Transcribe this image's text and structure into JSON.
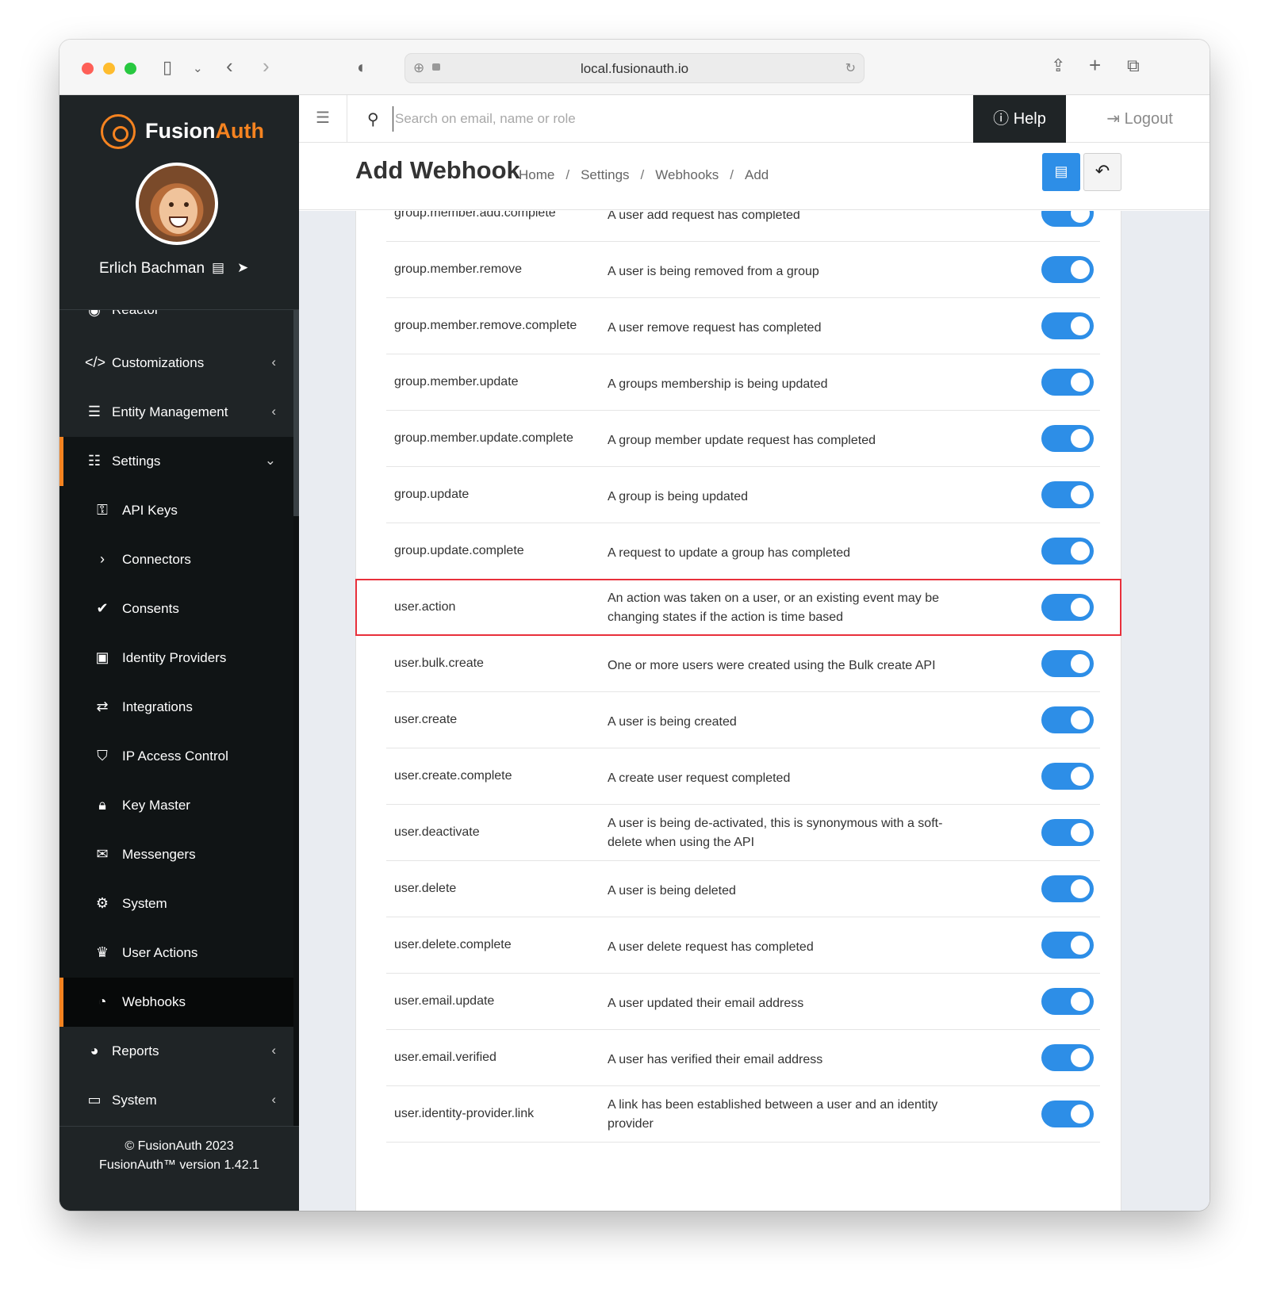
{
  "browser": {
    "url": "local.fusionauth.io"
  },
  "sidebar": {
    "brand_prefix": "Fusion",
    "brand_suffix": "Auth",
    "user_name": "Erlich Bachman",
    "partial_item": "Reactor",
    "items": [
      {
        "label": "Customizations",
        "icon": "code-icon"
      },
      {
        "label": "Entity Management",
        "icon": "server-icon"
      },
      {
        "label": "Settings",
        "icon": "sliders-icon"
      },
      {
        "label": "API Keys",
        "icon": "key-icon"
      },
      {
        "label": "Connectors",
        "icon": "chevron-right-icon"
      },
      {
        "label": "Consents",
        "icon": "check-icon"
      },
      {
        "label": "Identity Providers",
        "icon": "id-badge-icon"
      },
      {
        "label": "Integrations",
        "icon": "exchange-icon"
      },
      {
        "label": "IP Access Control",
        "icon": "shield-icon"
      },
      {
        "label": "Key Master",
        "icon": "lock-icon"
      },
      {
        "label": "Messengers",
        "icon": "comments-icon"
      },
      {
        "label": "System",
        "icon": "cog-icon"
      },
      {
        "label": "User Actions",
        "icon": "trophy-icon"
      },
      {
        "label": "Webhooks",
        "icon": "rss-icon"
      },
      {
        "label": "Reports",
        "icon": "pie-chart-icon"
      },
      {
        "label": "System",
        "icon": "desktop-icon"
      }
    ],
    "footer_copyright": "© FusionAuth 2023",
    "footer_version": "FusionAuth™ version 1.42.1"
  },
  "topbar": {
    "search_placeholder": "Search on email, name or role",
    "help_label": "Help",
    "logout_label": "Logout"
  },
  "page": {
    "title": "Add Webhook",
    "breadcrumbs": [
      "Home",
      "Settings",
      "Webhooks",
      "Add"
    ]
  },
  "events": [
    {
      "name": "group.member.add.complete",
      "description": "A user add request has completed",
      "enabled": true
    },
    {
      "name": "group.member.remove",
      "description": "A user is being removed from a group",
      "enabled": true
    },
    {
      "name": "group.member.remove.complete",
      "description": "A user remove request has completed",
      "enabled": true
    },
    {
      "name": "group.member.update",
      "description": "A groups membership is being updated",
      "enabled": true
    },
    {
      "name": "group.member.update.complete",
      "description": "A group member update request has completed",
      "enabled": true
    },
    {
      "name": "group.update",
      "description": "A group is being updated",
      "enabled": true
    },
    {
      "name": "group.update.complete",
      "description": "A request to update a group has completed",
      "enabled": true
    },
    {
      "name": "user.action",
      "description": "An action was taken on a user, or an existing event may be changing states if the action is time based",
      "enabled": true
    },
    {
      "name": "user.bulk.create",
      "description": "One or more users were created using the Bulk create API",
      "enabled": true
    },
    {
      "name": "user.create",
      "description": "A user is being created",
      "enabled": true
    },
    {
      "name": "user.create.complete",
      "description": "A create user request completed",
      "enabled": true
    },
    {
      "name": "user.deactivate",
      "description": "A user is being de-activated, this is synonymous with a soft-delete when using the API",
      "enabled": true
    },
    {
      "name": "user.delete",
      "description": "A user is being deleted",
      "enabled": true
    },
    {
      "name": "user.delete.complete",
      "description": "A user delete request has completed",
      "enabled": true
    },
    {
      "name": "user.email.update",
      "description": "A user updated their email address",
      "enabled": true
    },
    {
      "name": "user.email.verified",
      "description": "A user has verified their email address",
      "enabled": true
    },
    {
      "name": "user.identity-provider.link",
      "description": "A link has been established between a user and an identity provider",
      "enabled": true
    }
  ],
  "colors": {
    "accent": "#2d8ee7",
    "brand_orange": "#f58320",
    "sidebar_bg": "#1f2426",
    "highlight": "#e8303b"
  }
}
